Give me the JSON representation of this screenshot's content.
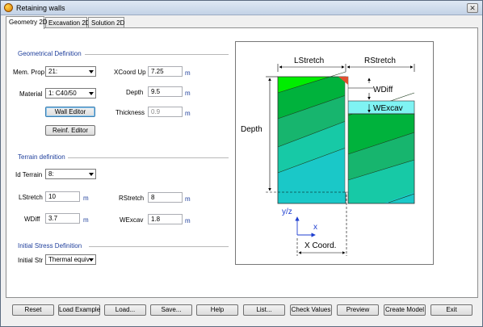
{
  "window": {
    "title": "Retaining walls",
    "close_glyph": "✕"
  },
  "tabs": [
    {
      "label": "Geometry 2D",
      "active": true
    },
    {
      "label": "Excavation 2D",
      "active": false
    },
    {
      "label": "Solution 2D",
      "active": false
    }
  ],
  "geometrical": {
    "title": "Geometrical Definition",
    "mem_prop_label": "Mem. Prop",
    "mem_prop_value": "21:",
    "material_label": "Material",
    "material_value": "1: C40/50",
    "wall_editor_button": "Wall Editor",
    "reinf_editor_button": "Reinf. Editor",
    "xcoord_up_label": "XCoord Up",
    "xcoord_up_value": "7.25",
    "depth_label": "Depth",
    "depth_value": "9.5",
    "thickness_label": "Thickness",
    "thickness_value": "0.9",
    "unit": "m"
  },
  "terrain": {
    "title": "Terrain definition",
    "id_label": "Id Terrain",
    "id_value": "8:",
    "lstretch_label": "LStretch",
    "lstretch_value": "10",
    "rstretch_label": "RStretch",
    "rstretch_value": "8",
    "wdiff_label": "WDiff",
    "wdiff_value": "3.7",
    "wexcav_label": "WExcav",
    "wexcav_value": "1.8",
    "unit": "m"
  },
  "initial_stress": {
    "title": "Initial Stress Definition",
    "label": "Initial Str",
    "value": "Thermal equiv"
  },
  "diagram": {
    "lstretch": "LStretch",
    "rstretch": "RStretch",
    "depth": "Depth",
    "wdiff": "WDiff",
    "wexcav": "WExcav",
    "yz": "y/z",
    "x": "x",
    "xcoord": "X Coord.",
    "colors": {
      "ground_top": "#00ee00",
      "layer2": "#00b23c",
      "layer3": "#17b56e",
      "layer4": "#17c9a6",
      "layer5": "#1ac8c8",
      "water": "#7ff3f3",
      "wall": "#ffffff",
      "axis": "#1f3fd0"
    }
  },
  "bottom_buttons": [
    "Reset",
    "Load Example",
    "Load...",
    "Save...",
    "Help",
    "List...",
    "Check Values",
    "Preview",
    "Create Model",
    "Exit"
  ]
}
